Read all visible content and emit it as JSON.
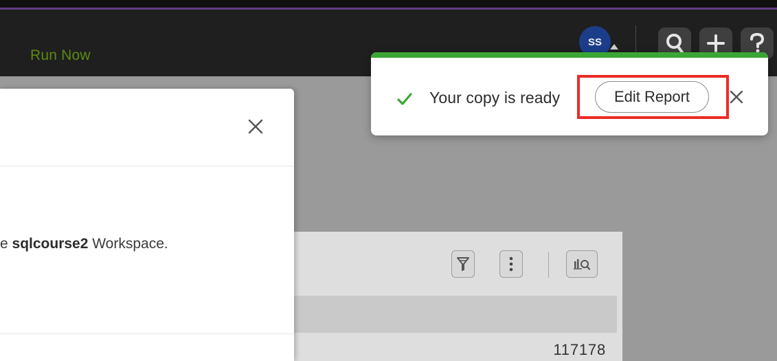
{
  "header": {
    "run_now_label": "Run Now",
    "avatar_initials": "SS",
    "icons": {
      "search": "search-icon",
      "add": "plus-icon",
      "help": "help-icon"
    }
  },
  "modal": {
    "message_prefix": "e ",
    "workspace_name": "sqlcourse2",
    "message_suffix": " Workspace.",
    "close_icon": "close-icon"
  },
  "report": {
    "icons": [
      "filter-icon",
      "more-icon",
      "explore-icon"
    ],
    "visible_value": "117178"
  },
  "toast": {
    "message": "Your copy is ready",
    "action_label": "Edit Report",
    "status_icon": "check-icon",
    "close_icon": "close-icon"
  },
  "colors": {
    "header_bg": "#1f1f1f",
    "accent_purple": "#5f3f84",
    "run_now_green": "#5c8a12",
    "avatar_blue": "#1b3d8a",
    "toast_strip_green": "#3aa634",
    "highlight_red": "#ee2a24"
  }
}
